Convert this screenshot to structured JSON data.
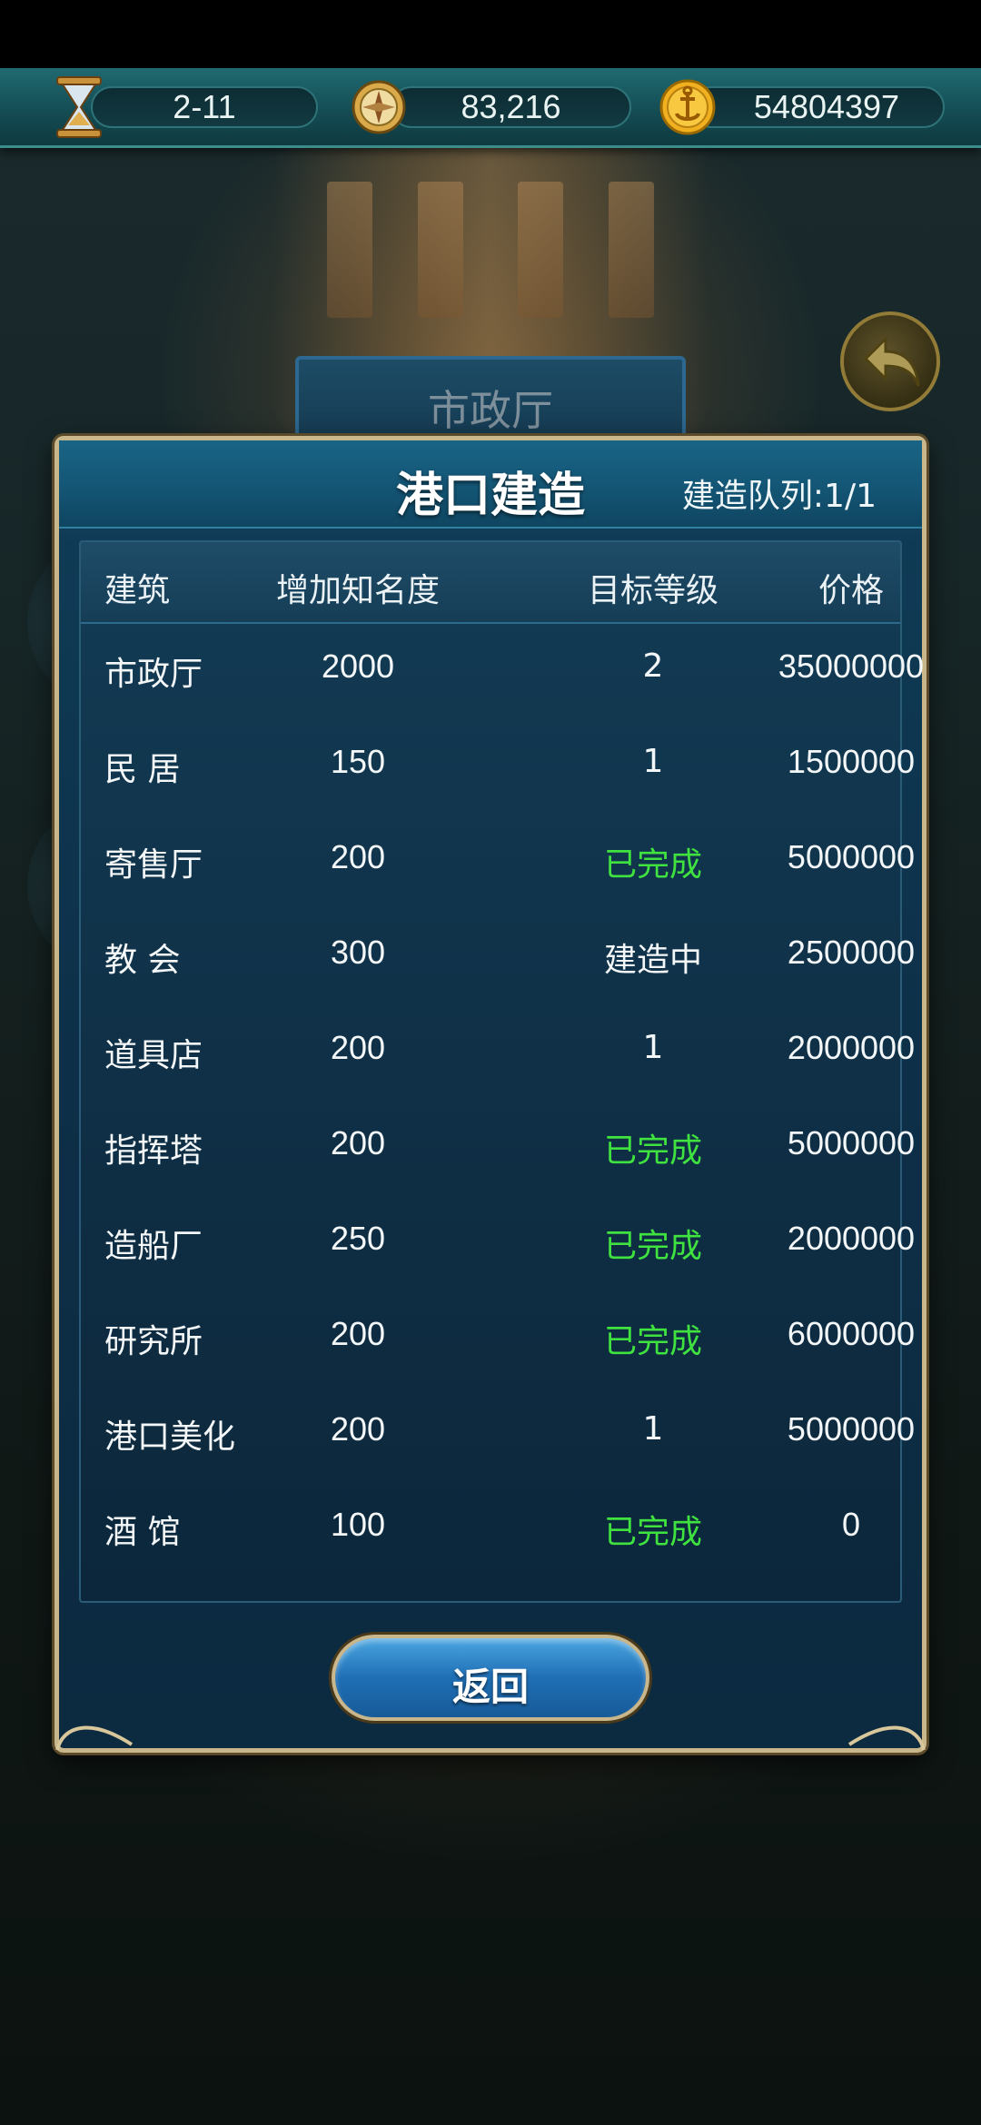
{
  "resources": {
    "chapter": {
      "icon": "hourglass-icon",
      "value": "2-11"
    },
    "fame": {
      "icon": "compass-icon",
      "value": "83,216"
    },
    "gold": {
      "icon": "anchor-coin-icon",
      "value": "54804397"
    }
  },
  "background": {
    "building_banner": "市政厅"
  },
  "panel": {
    "title": "港口建造",
    "queue_label": "建造队列:1/1",
    "columns": [
      "建筑",
      "增加知名度",
      "目标等级",
      "价格"
    ],
    "rows": [
      {
        "name": "市政厅",
        "fame": "2000",
        "level": "2",
        "price": "35000000",
        "done": false
      },
      {
        "name": "民  居",
        "fame": "150",
        "level": "1",
        "price": "1500000",
        "done": false
      },
      {
        "name": "寄售厅",
        "fame": "200",
        "level": "已完成",
        "price": "5000000",
        "done": true
      },
      {
        "name": "教  会",
        "fame": "300",
        "level": "建造中",
        "price": "2500000",
        "done": false
      },
      {
        "name": "道具店",
        "fame": "200",
        "level": "1",
        "price": "2000000",
        "done": false
      },
      {
        "name": "指挥塔",
        "fame": "200",
        "level": "已完成",
        "price": "5000000",
        "done": true
      },
      {
        "name": "造船厂",
        "fame": "250",
        "level": "已完成",
        "price": "2000000",
        "done": true
      },
      {
        "name": "研究所",
        "fame": "200",
        "level": "已完成",
        "price": "6000000",
        "done": true
      },
      {
        "name": "港口美化",
        "fame": "200",
        "level": "1",
        "price": "5000000",
        "done": false
      },
      {
        "name": "酒  馆",
        "fame": "100",
        "level": "已完成",
        "price": "0",
        "done": true
      }
    ],
    "back_button": "返回"
  },
  "colors": {
    "done_text": "#3fe23f",
    "panel_border": "#c9b68b",
    "header_bar": "#1a6486"
  }
}
